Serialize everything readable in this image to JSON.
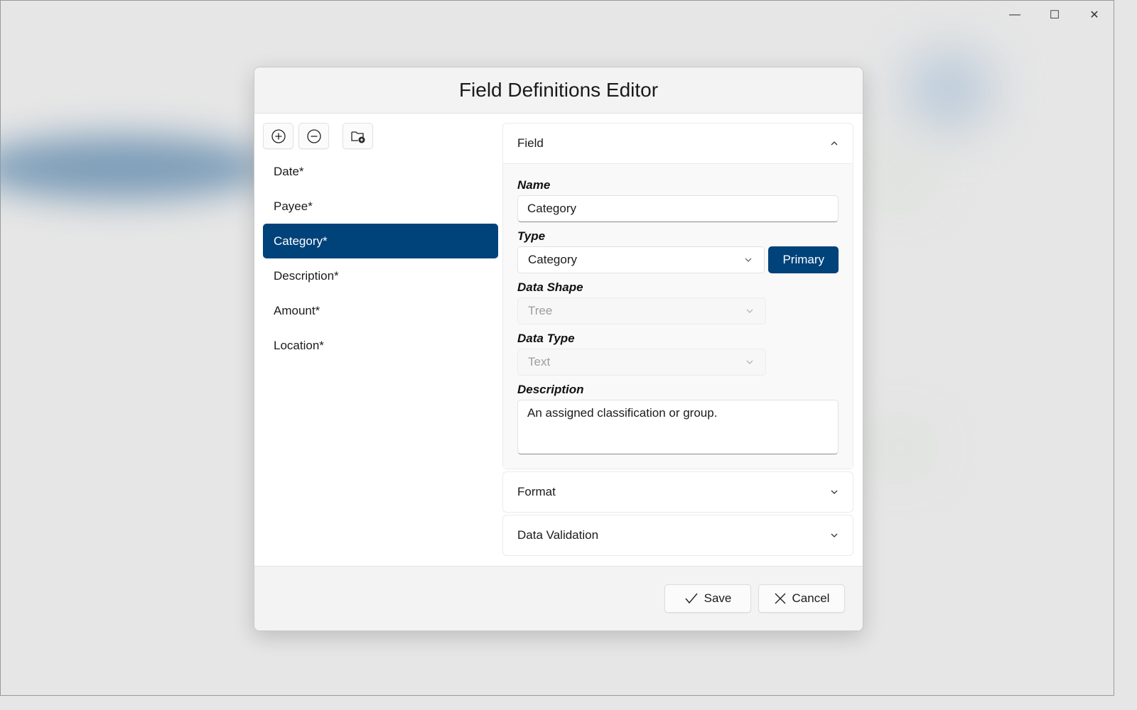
{
  "window": {
    "controls": {
      "minimize": "—",
      "maximize": "☐",
      "close": "✕"
    }
  },
  "dialog": {
    "title": "Field Definitions Editor",
    "toolbar": {
      "add_icon": "plus-circle-icon",
      "remove_icon": "minus-circle-icon",
      "add_folder_icon": "folder-add-icon"
    },
    "fields": [
      {
        "label": "Date*",
        "selected": false
      },
      {
        "label": "Payee*",
        "selected": false
      },
      {
        "label": "Category*",
        "selected": true
      },
      {
        "label": "Description*",
        "selected": false
      },
      {
        "label": "Amount*",
        "selected": false
      },
      {
        "label": "Location*",
        "selected": false
      }
    ],
    "nav_buttons": [
      "move-up",
      "move-down",
      "move-left",
      "move-right"
    ],
    "sections": {
      "field": {
        "title": "Field",
        "expanded": true,
        "name_label": "Name",
        "name_value": "Category",
        "type_label": "Type",
        "type_value": "Category",
        "primary_label": "Primary",
        "data_shape_label": "Data Shape",
        "data_shape_value": "Tree",
        "data_type_label": "Data Type",
        "data_type_value": "Text",
        "description_label": "Description",
        "description_value": "An assigned classification or group."
      },
      "format": {
        "title": "Format",
        "expanded": false
      },
      "validation": {
        "title": "Data Validation",
        "expanded": false
      }
    },
    "footer": {
      "save_label": "Save",
      "cancel_label": "Cancel"
    }
  },
  "colors": {
    "accent": "#00427a"
  }
}
